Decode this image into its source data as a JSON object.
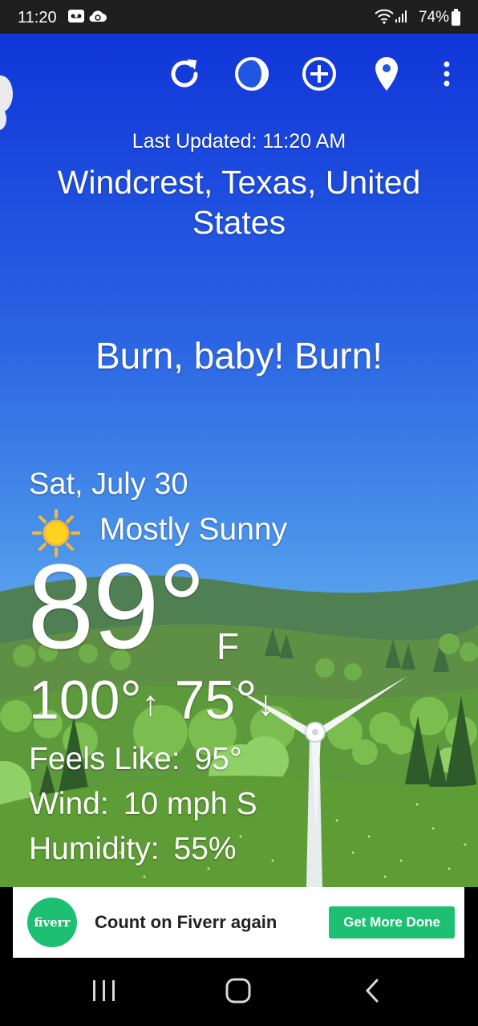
{
  "status_bar": {
    "time": "11:20",
    "battery_percent": "74%",
    "icons": [
      "voicemail-icon",
      "cloud-sync-icon",
      "wifi-icon",
      "signal-icon",
      "battery-icon"
    ]
  },
  "toolbar": {
    "buttons": [
      "refresh-icon",
      "moon-phase-icon",
      "add-location-icon",
      "location-pin-icon",
      "overflow-menu-icon"
    ]
  },
  "header": {
    "last_updated": "Last Updated: 11:20 AM",
    "location": "Windcrest, Texas, United States"
  },
  "slogan": "Burn, baby! Burn!",
  "weather": {
    "date": "Sat, July 30",
    "condition_icon": "sun-icon",
    "condition": "Mostly Sunny",
    "temperature": "89°",
    "unit": "F",
    "high": "100°",
    "high_arrow": "↑",
    "low": "75°",
    "low_arrow": "↓",
    "details": [
      {
        "label": "Feels Like:",
        "value": "95°"
      },
      {
        "label": "Wind:",
        "value": "10 mph S"
      },
      {
        "label": "Humidity:",
        "value": "55%"
      }
    ]
  },
  "ad": {
    "logo_text": "fiverr",
    "headline": "Count on Fiverr again",
    "cta": "Get More Done"
  },
  "nav_bar": {
    "buttons": [
      "recent-apps-icon",
      "home-icon",
      "back-icon"
    ]
  },
  "colors": {
    "sky_top": "#1035d9",
    "sky_bottom": "#79bdf2",
    "grass": "#5c9a3b",
    "fiverr_green": "#1dbf73"
  }
}
